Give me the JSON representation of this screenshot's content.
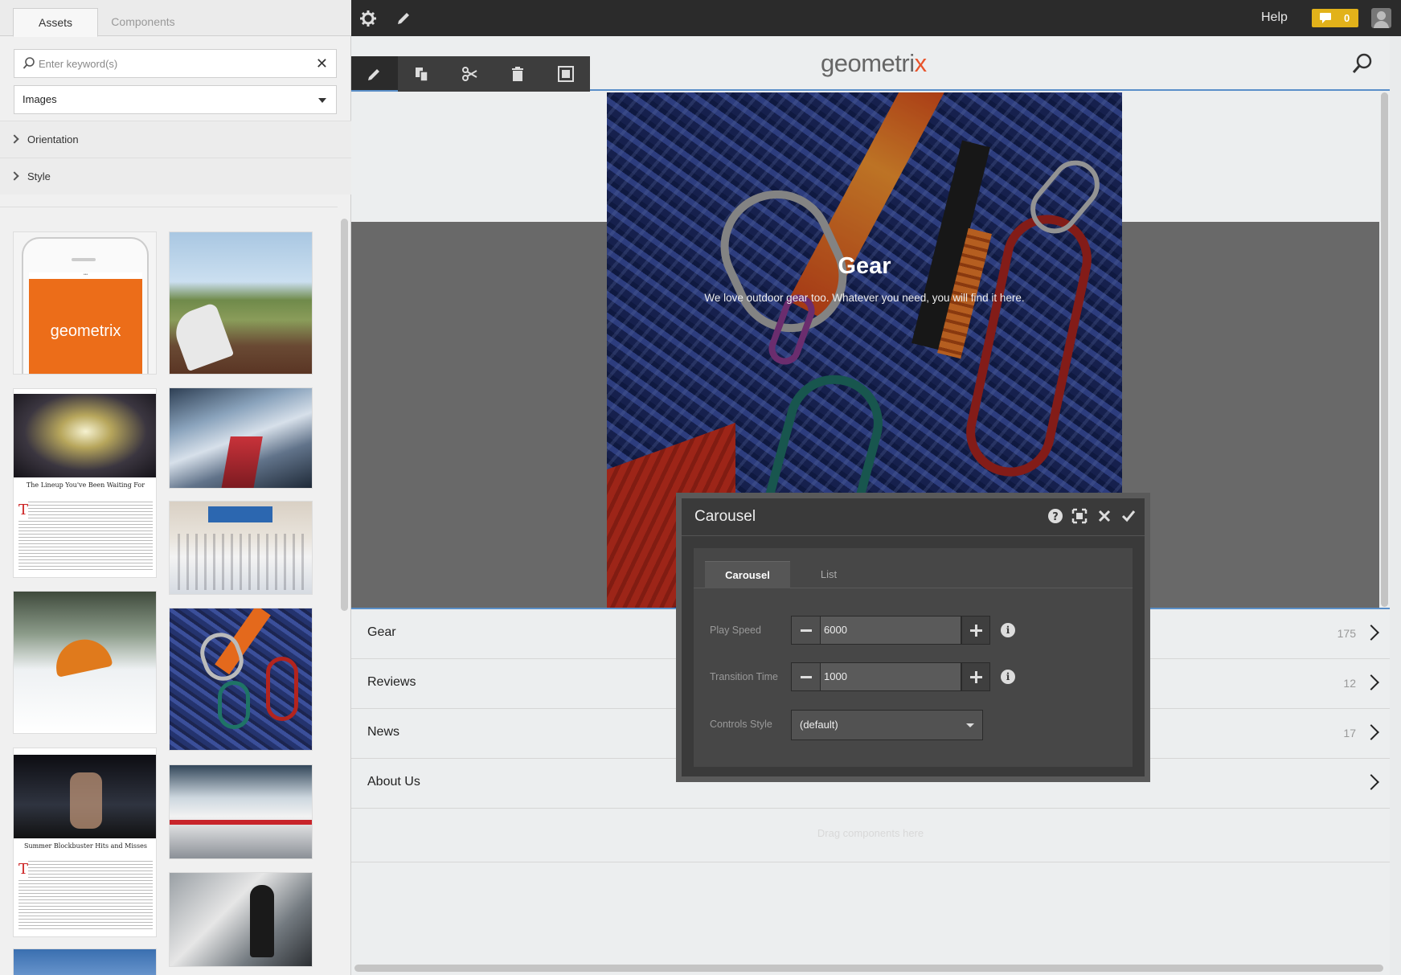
{
  "sidebar": {
    "tabs": [
      {
        "label": "Assets"
      },
      {
        "label": "Components"
      }
    ],
    "search": {
      "placeholder": "Enter keyword(s)",
      "value": ""
    },
    "type_select": {
      "selected": "Images"
    },
    "filters": [
      {
        "label": "Orientation"
      },
      {
        "label": "Style"
      }
    ],
    "thumbnails": {
      "phone_logo": "geometrix",
      "article1_title": "The Lineup You've Been Waiting For",
      "article2_title": "Summer Blockbuster Hits and Misses"
    }
  },
  "topbar": {
    "settings_icon": "gear-icon",
    "edit_icon": "pencil-icon",
    "help_label": "Help",
    "notification_count": "0",
    "notification_color": "#e2b21a"
  },
  "site": {
    "logo_left": "geometri",
    "logo_accent": "x",
    "logo_accent_color": "#e8542c",
    "hero_title": "Gear",
    "hero_subtitle": "We love outdoor gear too. Whatever you need, you will find it here.",
    "nav": [
      {
        "label": "Gear",
        "count": "175"
      },
      {
        "label": "Reviews",
        "count": "12"
      },
      {
        "label": "News",
        "count": "17"
      },
      {
        "label": "About Us",
        "count": ""
      }
    ],
    "drag_hint": "Drag components here",
    "selection_color": "#5a8fc9"
  },
  "edit_toolbar": {
    "icons": [
      "pencil-icon",
      "copy-icon",
      "cut-icon",
      "trash-icon",
      "group-icon"
    ]
  },
  "dialog": {
    "title": "Carousel",
    "tabs": [
      {
        "label": "Carousel"
      },
      {
        "label": "List"
      }
    ],
    "play_speed": {
      "label": "Play Speed",
      "value": "6000"
    },
    "transition_time": {
      "label": "Transition Time",
      "value": "1000"
    },
    "controls_style": {
      "label": "Controls Style",
      "selected": "(default)"
    }
  }
}
